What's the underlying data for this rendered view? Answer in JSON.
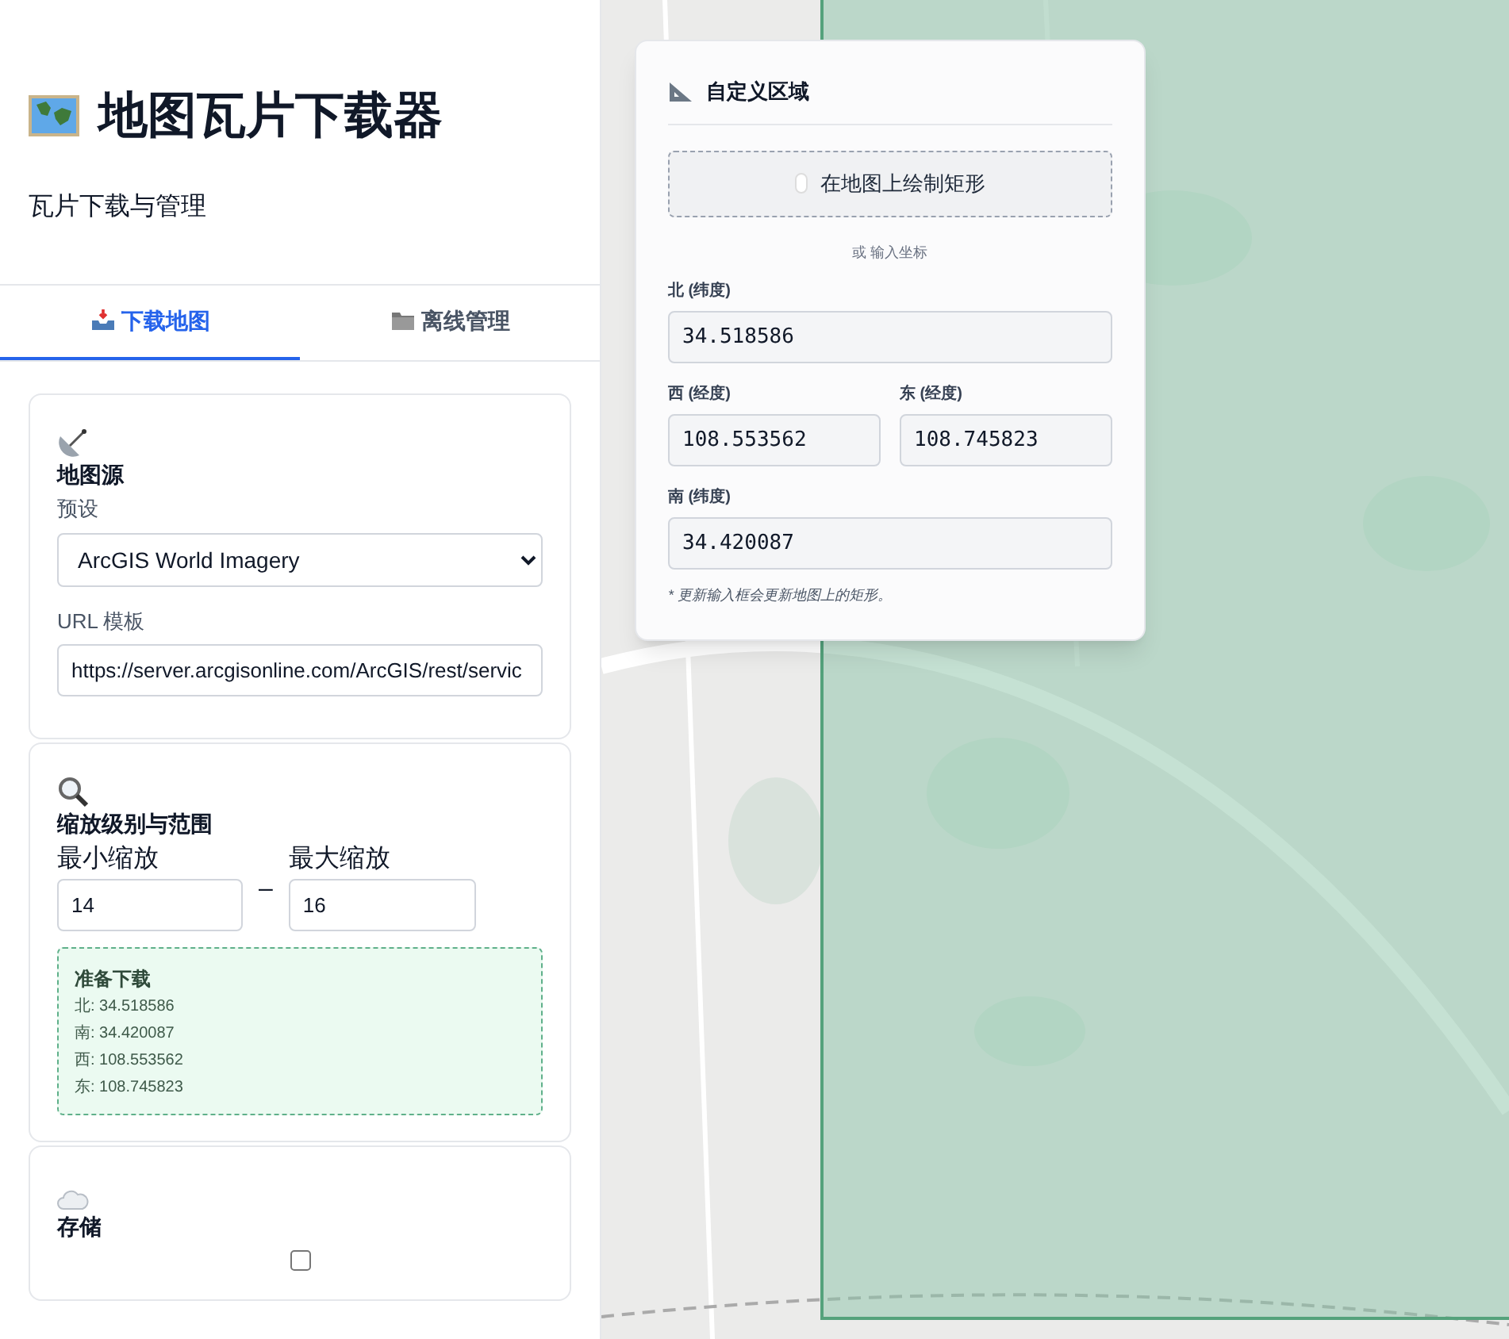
{
  "header": {
    "title": "地图瓦片下载器",
    "subtitle": "瓦片下载与管理"
  },
  "tabs": [
    {
      "label": "下载地图",
      "selected": true
    },
    {
      "label": "离线管理",
      "selected": false
    }
  ],
  "source_card": {
    "title": "地图源",
    "preset_label": "预设",
    "preset_value": "ArcGIS World Imagery",
    "url_label": "URL 模板",
    "url_value": "https://server.arcgisonline.com/ArcGIS/rest/servic"
  },
  "zoom_card": {
    "title": "缩放级别与范围",
    "min_label": "最小缩放",
    "min_value": "14",
    "separator": "–",
    "max_label": "最大缩放",
    "max_value": "16",
    "ready": {
      "title": "准备下载",
      "lines": [
        "北: 34.518586",
        "南: 34.420087",
        "西: 108.553562",
        "东: 108.745823"
      ]
    }
  },
  "storage_card": {
    "title": "存储",
    "checked": false
  },
  "region_panel": {
    "title": "自定义区域",
    "draw_button": "在地图上绘制矩形",
    "or_text": "或 输入坐标",
    "north_label": "北 (纬度)",
    "north_value": "34.518586",
    "west_label": "西 (经度)",
    "west_value": "108.553562",
    "east_label": "东 (经度)",
    "east_value": "108.745823",
    "south_label": "南 (纬度)",
    "south_value": "34.420087",
    "note": "* 更新输入框会更新地图上的矩形。"
  },
  "map": {
    "selection_visible": true
  }
}
